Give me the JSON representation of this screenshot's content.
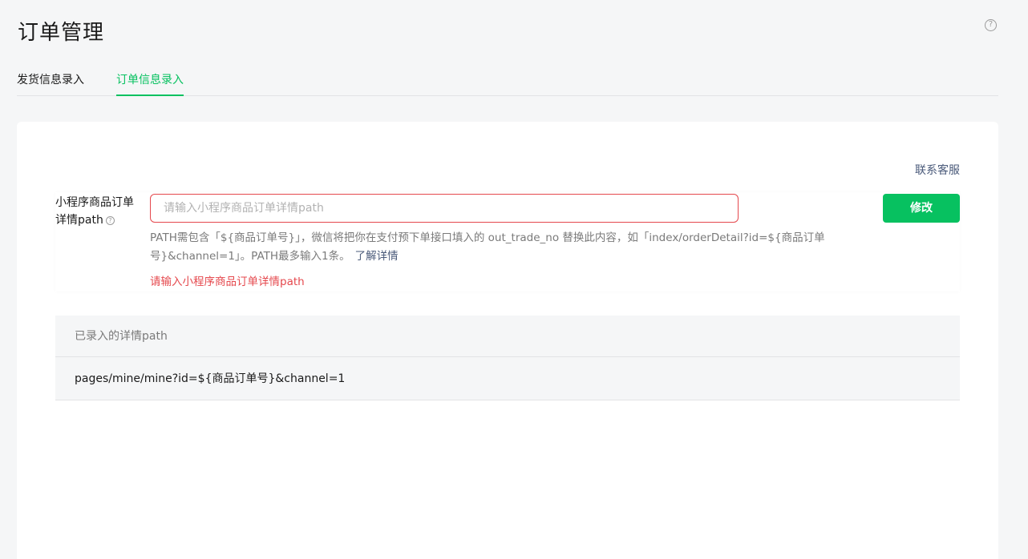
{
  "page": {
    "title": "订单管理",
    "help_icon": "question-circle-icon",
    "help_glyph": "?"
  },
  "tabs": [
    {
      "label": "发货信息录入",
      "active": false
    },
    {
      "label": "订单信息录入",
      "active": true
    }
  ],
  "card": {
    "contact_label": "联系客服",
    "form": {
      "label_line1": "小程序商品订单",
      "label_line2": "详情path",
      "label_help_glyph": "?",
      "input_placeholder": "请输入小程序商品订单详情path",
      "input_value": "",
      "submit_label": "修改",
      "hint_text": "PATH需包含「${商品订单号}」，微信将把你在支付预下单接口填入的 out_trade_no 替换此内容，如「index/orderDetail?id=${商品订单号}&channel=1」。PATH最多输入1条。",
      "hint_link": "了解详情",
      "error_text": "请输入小程序商品订单详情path"
    },
    "list": {
      "header": "已录入的详情path",
      "rows": [
        "pages/mine/mine?id=${商品订单号}&channel=1"
      ]
    }
  },
  "colors": {
    "accent": "#07c160",
    "error": "#e5484d",
    "link": "#4a5a7a"
  }
}
